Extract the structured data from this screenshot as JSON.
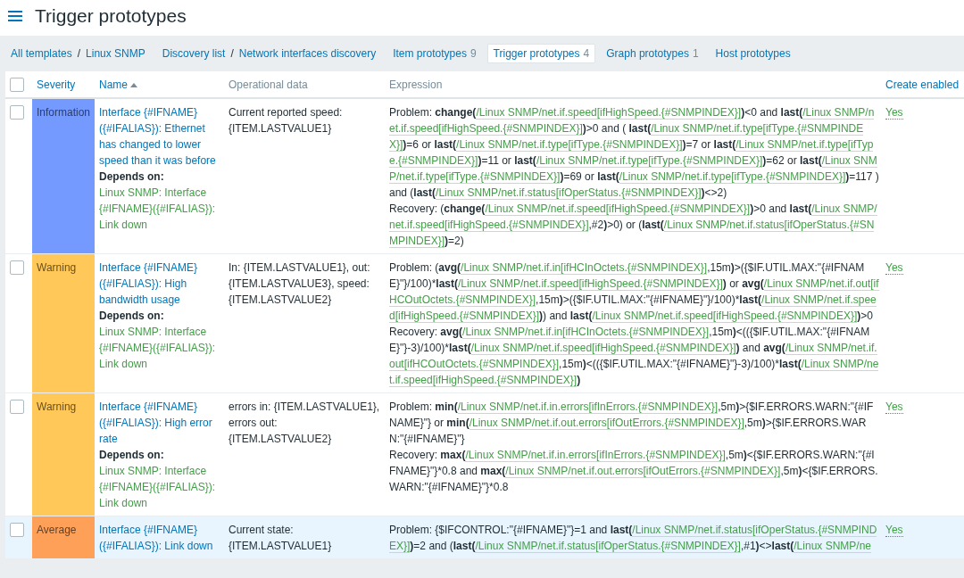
{
  "header": {
    "title": "Trigger prototypes"
  },
  "navigation": {
    "breadcrumbs": [
      {
        "parts": [
          {
            "kind": "link",
            "text": "All templates"
          },
          {
            "kind": "separator",
            "text": "/"
          },
          {
            "kind": "link",
            "text": "Linux SNMP"
          }
        ]
      },
      {
        "parts": [
          {
            "kind": "link",
            "text": "Discovery list"
          },
          {
            "kind": "separator",
            "text": "/"
          },
          {
            "kind": "link",
            "text": "Network interfaces discovery"
          }
        ]
      }
    ],
    "tabs": [
      {
        "label": "Item prototypes",
        "count": "9",
        "selected": false
      },
      {
        "label": "Trigger prototypes",
        "count": "4",
        "selected": true
      },
      {
        "label": "Graph prototypes",
        "count": "1",
        "selected": false
      },
      {
        "label": "Host prototypes",
        "selected": false
      }
    ]
  },
  "table": {
    "select_all": {
      "checked": false
    },
    "columns": [
      {
        "label": "Severity",
        "sortable": true,
        "sorted": false
      },
      {
        "label": "Name",
        "sortable": true,
        "sorted": true
      },
      {
        "label": "Operational data",
        "sortable": false,
        "sorted": false
      },
      {
        "label": "Expression",
        "sortable": false,
        "sorted": false
      },
      {
        "label": "Create enabled",
        "sortable": true,
        "sorted": false
      }
    ],
    "rows": [
      {
        "checked": false,
        "highlighted": false,
        "severity": {
          "text": "Information",
          "color": "#7499ff"
        },
        "name": "Interface {#IFNAME}({#IFALIAS}): Ethernet has changed to lower speed than it was before",
        "depends_label": "Depends on:",
        "dependencies": [
          "Linux SNMP: Interface {#IFNAME}({#IFALIAS}): Link down"
        ],
        "operational_data": "Current reported speed: {ITEM.LASTVALUE1}",
        "expression": [
          {
            "parts": [
              {
                "kind": "plain",
                "text": "Problem: "
              },
              {
                "kind": "bold",
                "text": "change("
              },
              {
                "kind": "item",
                "text": "/Linux SNMP/net.if.speed[ifHighSpeed.{#SNMPINDEX}]"
              },
              {
                "kind": "bold",
                "text": ")"
              },
              {
                "kind": "plain",
                "text": "<0 and "
              },
              {
                "kind": "bold",
                "text": "last("
              },
              {
                "kind": "item",
                "text": "/Linux SNMP/net.if.speed[ifHighSpeed.{#SNMPINDEX}]"
              },
              {
                "kind": "bold",
                "text": ")"
              },
              {
                "kind": "plain",
                "text": ">0 and ( "
              },
              {
                "kind": "bold",
                "text": "last("
              },
              {
                "kind": "item",
                "text": "/Linux SNMP/net.if.type[ifType.{#SNMPINDEX}]"
              },
              {
                "kind": "bold",
                "text": ")"
              },
              {
                "kind": "plain",
                "text": "=6 or "
              },
              {
                "kind": "bold",
                "text": "last("
              },
              {
                "kind": "item",
                "text": "/Linux SNMP/net.if.type[ifType.{#SNMPINDEX}]"
              },
              {
                "kind": "bold",
                "text": ")"
              },
              {
                "kind": "plain",
                "text": "=7 or "
              },
              {
                "kind": "bold",
                "text": "last("
              },
              {
                "kind": "item",
                "text": "/Linux SNMP/net.if.type[ifType.{#SNMPINDEX}]"
              },
              {
                "kind": "bold",
                "text": ")"
              },
              {
                "kind": "plain",
                "text": "=11 or "
              },
              {
                "kind": "bold",
                "text": "last("
              },
              {
                "kind": "item",
                "text": "/Linux SNMP/net.if.type[ifType.{#SNMPINDEX}]"
              },
              {
                "kind": "bold",
                "text": ")"
              },
              {
                "kind": "plain",
                "text": "=62 or "
              },
              {
                "kind": "bold",
                "text": "last("
              },
              {
                "kind": "item",
                "text": "/Linux SNMP/net.if.type[ifType.{#SNMPINDEX}]"
              },
              {
                "kind": "bold",
                "text": ")"
              },
              {
                "kind": "plain",
                "text": "=69 or "
              },
              {
                "kind": "bold",
                "text": "last("
              },
              {
                "kind": "item",
                "text": "/Linux SNMP/net.if.type[ifType.{#SNMPINDEX}]"
              },
              {
                "kind": "bold",
                "text": ")"
              },
              {
                "kind": "plain",
                "text": "=117 ) and ("
              },
              {
                "kind": "bold",
                "text": "last("
              },
              {
                "kind": "item",
                "text": "/Linux SNMP/net.if.status[ifOperStatus.{#SNMPINDEX}]"
              },
              {
                "kind": "bold",
                "text": ")"
              },
              {
                "kind": "plain",
                "text": "<>2)"
              }
            ]
          },
          {
            "parts": [
              {
                "kind": "plain",
                "text": "Recovery: ("
              },
              {
                "kind": "bold",
                "text": "change("
              },
              {
                "kind": "item",
                "text": "/Linux SNMP/net.if.speed[ifHighSpeed.{#SNMPINDEX}]"
              },
              {
                "kind": "bold",
                "text": ")"
              },
              {
                "kind": "plain",
                "text": ">0 and "
              },
              {
                "kind": "bold",
                "text": "last("
              },
              {
                "kind": "item",
                "text": "/Linux SNMP/net.if.speed[ifHighSpeed.{#SNMPINDEX}]"
              },
              {
                "kind": "plain",
                "text": ",#2"
              },
              {
                "kind": "bold",
                "text": ")"
              },
              {
                "kind": "plain",
                "text": ">0) or ("
              },
              {
                "kind": "bold",
                "text": "last("
              },
              {
                "kind": "item",
                "text": "/Linux SNMP/net.if.status[ifOperStatus.{#SNMPINDEX}]"
              },
              {
                "kind": "bold",
                "text": ")"
              },
              {
                "kind": "plain",
                "text": "=2)"
              }
            ]
          }
        ],
        "create_enabled": {
          "text": "Yes",
          "on": true
        }
      },
      {
        "checked": false,
        "highlighted": false,
        "severity": {
          "text": "Warning",
          "color": "#ffc859"
        },
        "name": "Interface {#IFNAME}({#IFALIAS}): High bandwidth usage",
        "depends_label": "Depends on:",
        "dependencies": [
          "Linux SNMP: Interface {#IFNAME}({#IFALIAS}): Link down"
        ],
        "operational_data": "In: {ITEM.LASTVALUE1}, out: {ITEM.LASTVALUE3}, speed: {ITEM.LASTVALUE2}",
        "expression": [
          {
            "parts": [
              {
                "kind": "plain",
                "text": "Problem: ("
              },
              {
                "kind": "bold",
                "text": "avg("
              },
              {
                "kind": "item",
                "text": "/Linux SNMP/net.if.in[ifHCInOctets.{#SNMPINDEX}]"
              },
              {
                "kind": "plain",
                "text": ",15m"
              },
              {
                "kind": "bold",
                "text": ")"
              },
              {
                "kind": "plain",
                "text": ">({$IF.UTIL.MAX:\"{#IFNAME}\"}/100)*"
              },
              {
                "kind": "bold",
                "text": "last("
              },
              {
                "kind": "item",
                "text": "/Linux SNMP/net.if.speed[ifHighSpeed.{#SNMPINDEX}]"
              },
              {
                "kind": "bold",
                "text": ")"
              },
              {
                "kind": "plain",
                "text": " or "
              },
              {
                "kind": "bold",
                "text": "avg("
              },
              {
                "kind": "item",
                "text": "/Linux SNMP/net.if.out[ifHCOutOctets.{#SNMPINDEX}]"
              },
              {
                "kind": "plain",
                "text": ",15m"
              },
              {
                "kind": "bold",
                "text": ")"
              },
              {
                "kind": "plain",
                "text": ">({$IF.UTIL.MAX:\"{#IFNAME}\"}/100)*"
              },
              {
                "kind": "bold",
                "text": "last("
              },
              {
                "kind": "item",
                "text": "/Linux SNMP/net.if.speed[ifHighSpeed.{#SNMPINDEX}]"
              },
              {
                "kind": "bold",
                "text": ")"
              },
              {
                "kind": "plain",
                "text": ") and "
              },
              {
                "kind": "bold",
                "text": "last("
              },
              {
                "kind": "item",
                "text": "/Linux SNMP/net.if.speed[ifHighSpeed.{#SNMPINDEX}]"
              },
              {
                "kind": "bold",
                "text": ")"
              },
              {
                "kind": "plain",
                "text": ">0"
              }
            ]
          },
          {
            "parts": [
              {
                "kind": "plain",
                "text": "Recovery: "
              },
              {
                "kind": "bold",
                "text": "avg("
              },
              {
                "kind": "item",
                "text": "/Linux SNMP/net.if.in[ifHCInOctets.{#SNMPINDEX}]"
              },
              {
                "kind": "plain",
                "text": ",15m"
              },
              {
                "kind": "bold",
                "text": ")"
              },
              {
                "kind": "plain",
                "text": "<(({$IF.UTIL.MAX:\"{#IFNAME}\"}-3)/100)*"
              },
              {
                "kind": "bold",
                "text": "last("
              },
              {
                "kind": "item",
                "text": "/Linux SNMP/net.if.speed[ifHighSpeed.{#SNMPINDEX}]"
              },
              {
                "kind": "bold",
                "text": ")"
              },
              {
                "kind": "plain",
                "text": " and "
              },
              {
                "kind": "bold",
                "text": "avg("
              },
              {
                "kind": "item",
                "text": "/Linux SNMP/net.if.out[ifHCOutOctets.{#SNMPINDEX}]"
              },
              {
                "kind": "plain",
                "text": ",15m"
              },
              {
                "kind": "bold",
                "text": ")"
              },
              {
                "kind": "plain",
                "text": "<(({$IF.UTIL.MAX:\"{#IFNAME}\"}-3)/100)*"
              },
              {
                "kind": "bold",
                "text": "last("
              },
              {
                "kind": "item",
                "text": "/Linux SNMP/net.if.speed[ifHighSpeed.{#SNMPINDEX}]"
              },
              {
                "kind": "bold",
                "text": ")"
              }
            ]
          }
        ],
        "create_enabled": {
          "text": "Yes",
          "on": true
        }
      },
      {
        "checked": false,
        "highlighted": false,
        "severity": {
          "text": "Warning",
          "color": "#ffc859"
        },
        "name": "Interface {#IFNAME}({#IFALIAS}): High error rate",
        "depends_label": "Depends on:",
        "dependencies": [
          "Linux SNMP: Interface {#IFNAME}({#IFALIAS}): Link down"
        ],
        "operational_data": "errors in: {ITEM.LASTVALUE1}, errors out: {ITEM.LASTVALUE2}",
        "expression": [
          {
            "parts": [
              {
                "kind": "plain",
                "text": "Problem: "
              },
              {
                "kind": "bold",
                "text": "min("
              },
              {
                "kind": "item",
                "text": "/Linux SNMP/net.if.in.errors[ifInErrors.{#SNMPINDEX}]"
              },
              {
                "kind": "plain",
                "text": ",5m"
              },
              {
                "kind": "bold",
                "text": ")"
              },
              {
                "kind": "plain",
                "text": ">{$IF.ERRORS.WARN:\"{#IFNAME}\"} or "
              },
              {
                "kind": "bold",
                "text": "min("
              },
              {
                "kind": "item",
                "text": "/Linux SNMP/net.if.out.errors[ifOutErrors.{#SNMPINDEX}]"
              },
              {
                "kind": "plain",
                "text": ",5m"
              },
              {
                "kind": "bold",
                "text": ")"
              },
              {
                "kind": "plain",
                "text": ">{$IF.ERRORS.WARN:\"{#IFNAME}\"}"
              }
            ]
          },
          {
            "parts": [
              {
                "kind": "plain",
                "text": "Recovery: "
              },
              {
                "kind": "bold",
                "text": "max("
              },
              {
                "kind": "item",
                "text": "/Linux SNMP/net.if.in.errors[ifInErrors.{#SNMPINDEX}]"
              },
              {
                "kind": "plain",
                "text": ",5m"
              },
              {
                "kind": "bold",
                "text": ")"
              },
              {
                "kind": "plain",
                "text": "<{$IF.ERRORS.WARN:\"{#IFNAME}\"}*0.8 and "
              },
              {
                "kind": "bold",
                "text": "max("
              },
              {
                "kind": "item",
                "text": "/Linux SNMP/net.if.out.errors[ifOutErrors.{#SNMPINDEX}]"
              },
              {
                "kind": "plain",
                "text": ",5m"
              },
              {
                "kind": "bold",
                "text": ")"
              },
              {
                "kind": "plain",
                "text": "<{$IF.ERRORS.WARN:\"{#IFNAME}\"}*0.8"
              }
            ]
          }
        ],
        "create_enabled": {
          "text": "Yes",
          "on": true
        }
      },
      {
        "checked": false,
        "highlighted": true,
        "severity": {
          "text": "Average",
          "color": "#ffa059"
        },
        "name": "Interface {#IFNAME}({#IFALIAS}): Link down",
        "operational_data": "Current state: {ITEM.LASTVALUE1}",
        "expression": [
          {
            "parts": [
              {
                "kind": "plain",
                "text": "Problem: {$IFCONTROL:\"{#IFNAME}\"}=1 and "
              },
              {
                "kind": "bold",
                "text": "last("
              },
              {
                "kind": "item",
                "text": "/Linux SNMP/net.if.status[ifOperStatus.{#SNMPINDEX}]"
              },
              {
                "kind": "bold",
                "text": ")"
              },
              {
                "kind": "plain",
                "text": "=2 and ("
              },
              {
                "kind": "bold",
                "text": "last("
              },
              {
                "kind": "item",
                "text": "/Linux SNMP/net.if.status[ifOperStatus.{#SNMPINDEX}]"
              },
              {
                "kind": "plain",
                "text": ",#1"
              },
              {
                "kind": "bold",
                "text": ")"
              },
              {
                "kind": "plain",
                "text": "<>"
              },
              {
                "kind": "bold",
                "text": "last("
              },
              {
                "kind": "item",
                "text": "/Linux SNMP/ne"
              }
            ]
          }
        ],
        "create_enabled": {
          "text": "Yes",
          "on": true
        }
      }
    ]
  }
}
